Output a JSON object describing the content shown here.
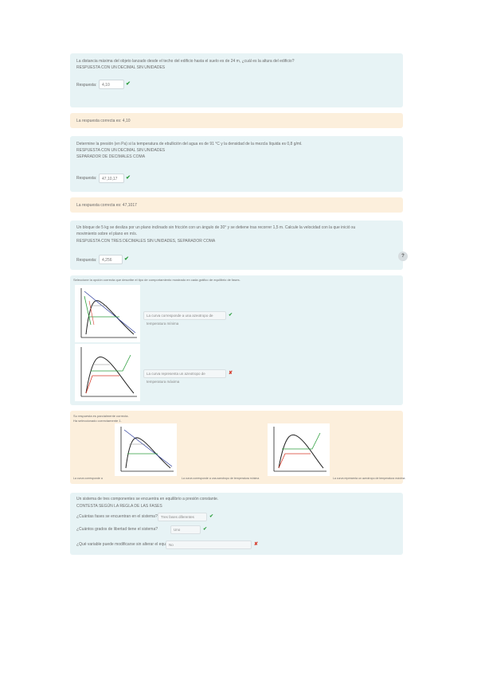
{
  "q1": {
    "line1": "La distancia máxima del objeto lanzado desde el techo del edificio hasta el suelo es de 24 m, ¿cuál es la altura del edificio?",
    "line2": "RESPUESTA CON UN DECIMAL SIN UNIDADES",
    "answer_label": "Respuesta:",
    "answer_value": "4,10"
  },
  "fb1": {
    "text": "La respuesta correcta es: 4,10"
  },
  "q2": {
    "line1": "Determine la presión (en Pa) si la temperatura de ebullición del agua es de 91 °C y la densidad de la mezcla líquida es 0,8 g/ml.",
    "line2": "RESPUESTA CON UN DECIMAL SIN UNIDADES",
    "line3": "SEPARADOR DE DECIMALES COMA",
    "answer_label": "Respuesta:",
    "answer_value": "47,10,17"
  },
  "fb2": {
    "text": "La respuesta correcta es: 47,1017"
  },
  "q3": {
    "line1": "Un bloque de 5 kg se desliza por un plano inclinado sin fricción con un ángulo de 30° y se detiene tras recorrer 1,5 m. Calcule la velocidad con la que inició su",
    "line2": "movimiento sobre el plano en m/s.",
    "line3": "RESPUESTA CON TRES DECIMALES SIN UNIDADES, SEPARADOR COMA",
    "answer_label": "Respuesta:",
    "answer_value": "4,256"
  },
  "help": {
    "symbol": "?"
  },
  "q4": {
    "instruction": "Seleccione la opción correcta que describe el tipo de comportamiento mostrado en cada gráfico de equilibrio de fases.",
    "select1": "La curva corresponde a una azeotropo de temperatura mínima",
    "select2": "La curva representa un azeotropo de temperatura máxima"
  },
  "fb4": {
    "line1": "Su respuesta es parcialmente correcta.",
    "line2": "Ha seleccionado correctamente 1.",
    "caption1": "La curva corresponde a",
    "caption2": "La curva corresponde a una azeotropo de temperatura mínima",
    "caption3": "La curva representa un azeotropo de temperatura máxima"
  },
  "q5": {
    "line1": "Un sistema de tres componentes se encuentra en equilibrio a presión constante.",
    "line2": "CONTESTA SEGÚN LA REGLA DE LAS FASES",
    "row1_label": "¿Cuántas fases se encuentran en el sistema?",
    "row1_value": "Tres fases diferentes",
    "row2_label": "¿Cuántos grados de libertad tiene el sistema?",
    "row2_value": "Uno",
    "row3_label": "¿Qué variable puede modificarse sin alterar el equilibrio?",
    "row3_value": "No"
  },
  "colors": {
    "correct": "#2e9e3e",
    "incorrect": "#d63a2a",
    "question_bg": "#e7f3f5",
    "feedback_bg": "#fcefdc"
  }
}
